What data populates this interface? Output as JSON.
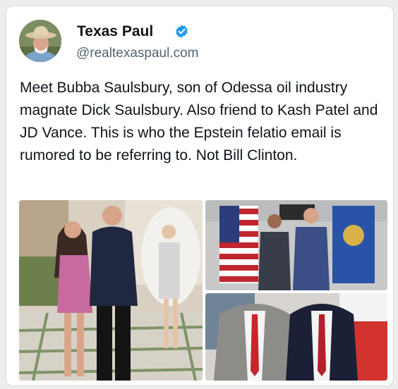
{
  "post": {
    "author_name": "Texas Paul",
    "handle": "@realtexaspaul.com",
    "verified_icon": "verified-badge-icon",
    "text": "Meet Bubba Saulsbury, son of Odessa oil industry magnate Dick Saulsbury.  Also friend to Kash Patel and JD Vance.  This is who the Epstein felatio email is rumored to be referring to.  Not Bill Clinton."
  },
  "colors": {
    "verified": "#1d9bf0",
    "text": "#0f1419",
    "secondary_text": "#536471"
  },
  "media": [
    {
      "name": "party-photo"
    },
    {
      "name": "fbi-office-photo"
    },
    {
      "name": "men-in-suits-photo"
    }
  ]
}
